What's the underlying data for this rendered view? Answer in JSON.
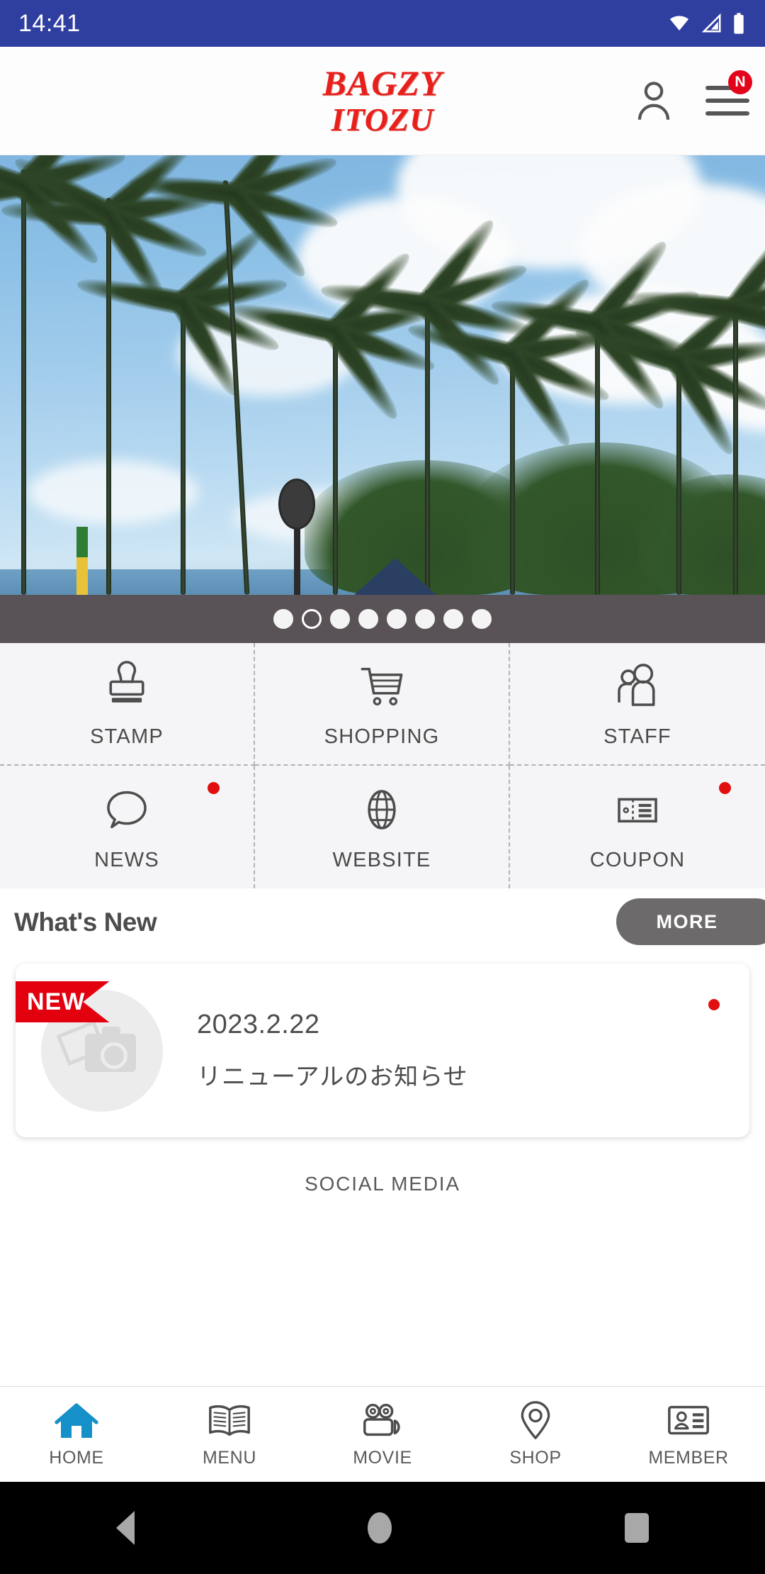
{
  "statusbar": {
    "time": "14:41",
    "icons": [
      "wifi-icon",
      "cellular-signal-icon",
      "battery-icon"
    ]
  },
  "header": {
    "logo_line1": "BAGZY",
    "logo_line2": "ITOZU",
    "logo_color": "#e8201c",
    "account_icon": "person-icon",
    "menu_icon": "hamburger-menu-icon",
    "menu_badge": "N",
    "badge_color": "#e2041b"
  },
  "hero": {
    "alt": "palm-trees-beach-photo",
    "carousel_total": 8,
    "carousel_active_index": 2
  },
  "grid_menu": {
    "items": [
      {
        "label": "STAMP",
        "icon": "stamp-icon",
        "badge": false
      },
      {
        "label": "SHOPPING",
        "icon": "shopping-cart-icon",
        "badge": false
      },
      {
        "label": "STAFF",
        "icon": "staff-people-icon",
        "badge": false
      },
      {
        "label": "NEWS",
        "icon": "speech-bubble-icon",
        "badge": true
      },
      {
        "label": "WEBSITE",
        "icon": "globe-icon",
        "badge": false
      },
      {
        "label": "COUPON",
        "icon": "ticket-icon",
        "badge": true
      }
    ]
  },
  "whats_new": {
    "title": "What's New",
    "more_label": "MORE",
    "card": {
      "ribbon": "NEW",
      "date": "2023.2.22",
      "title": "リニューアルのお知らせ",
      "thumbnail_icon": "photo-placeholder-icon",
      "unread": true
    }
  },
  "social": {
    "label": "SOCIAL MEDIA"
  },
  "bottom_nav": {
    "items": [
      {
        "label": "HOME",
        "icon": "home-icon",
        "active": true
      },
      {
        "label": "MENU",
        "icon": "book-icon",
        "active": false
      },
      {
        "label": "MOVIE",
        "icon": "video-camera-icon",
        "active": false
      },
      {
        "label": "SHOP",
        "icon": "map-pin-icon",
        "active": false
      },
      {
        "label": "MEMBER",
        "icon": "id-card-icon",
        "active": false
      }
    ],
    "active_color": "#1590c9"
  },
  "android_nav": {
    "back": "back-triangle-icon",
    "home": "home-circle-icon",
    "recents": "recents-square-icon"
  }
}
